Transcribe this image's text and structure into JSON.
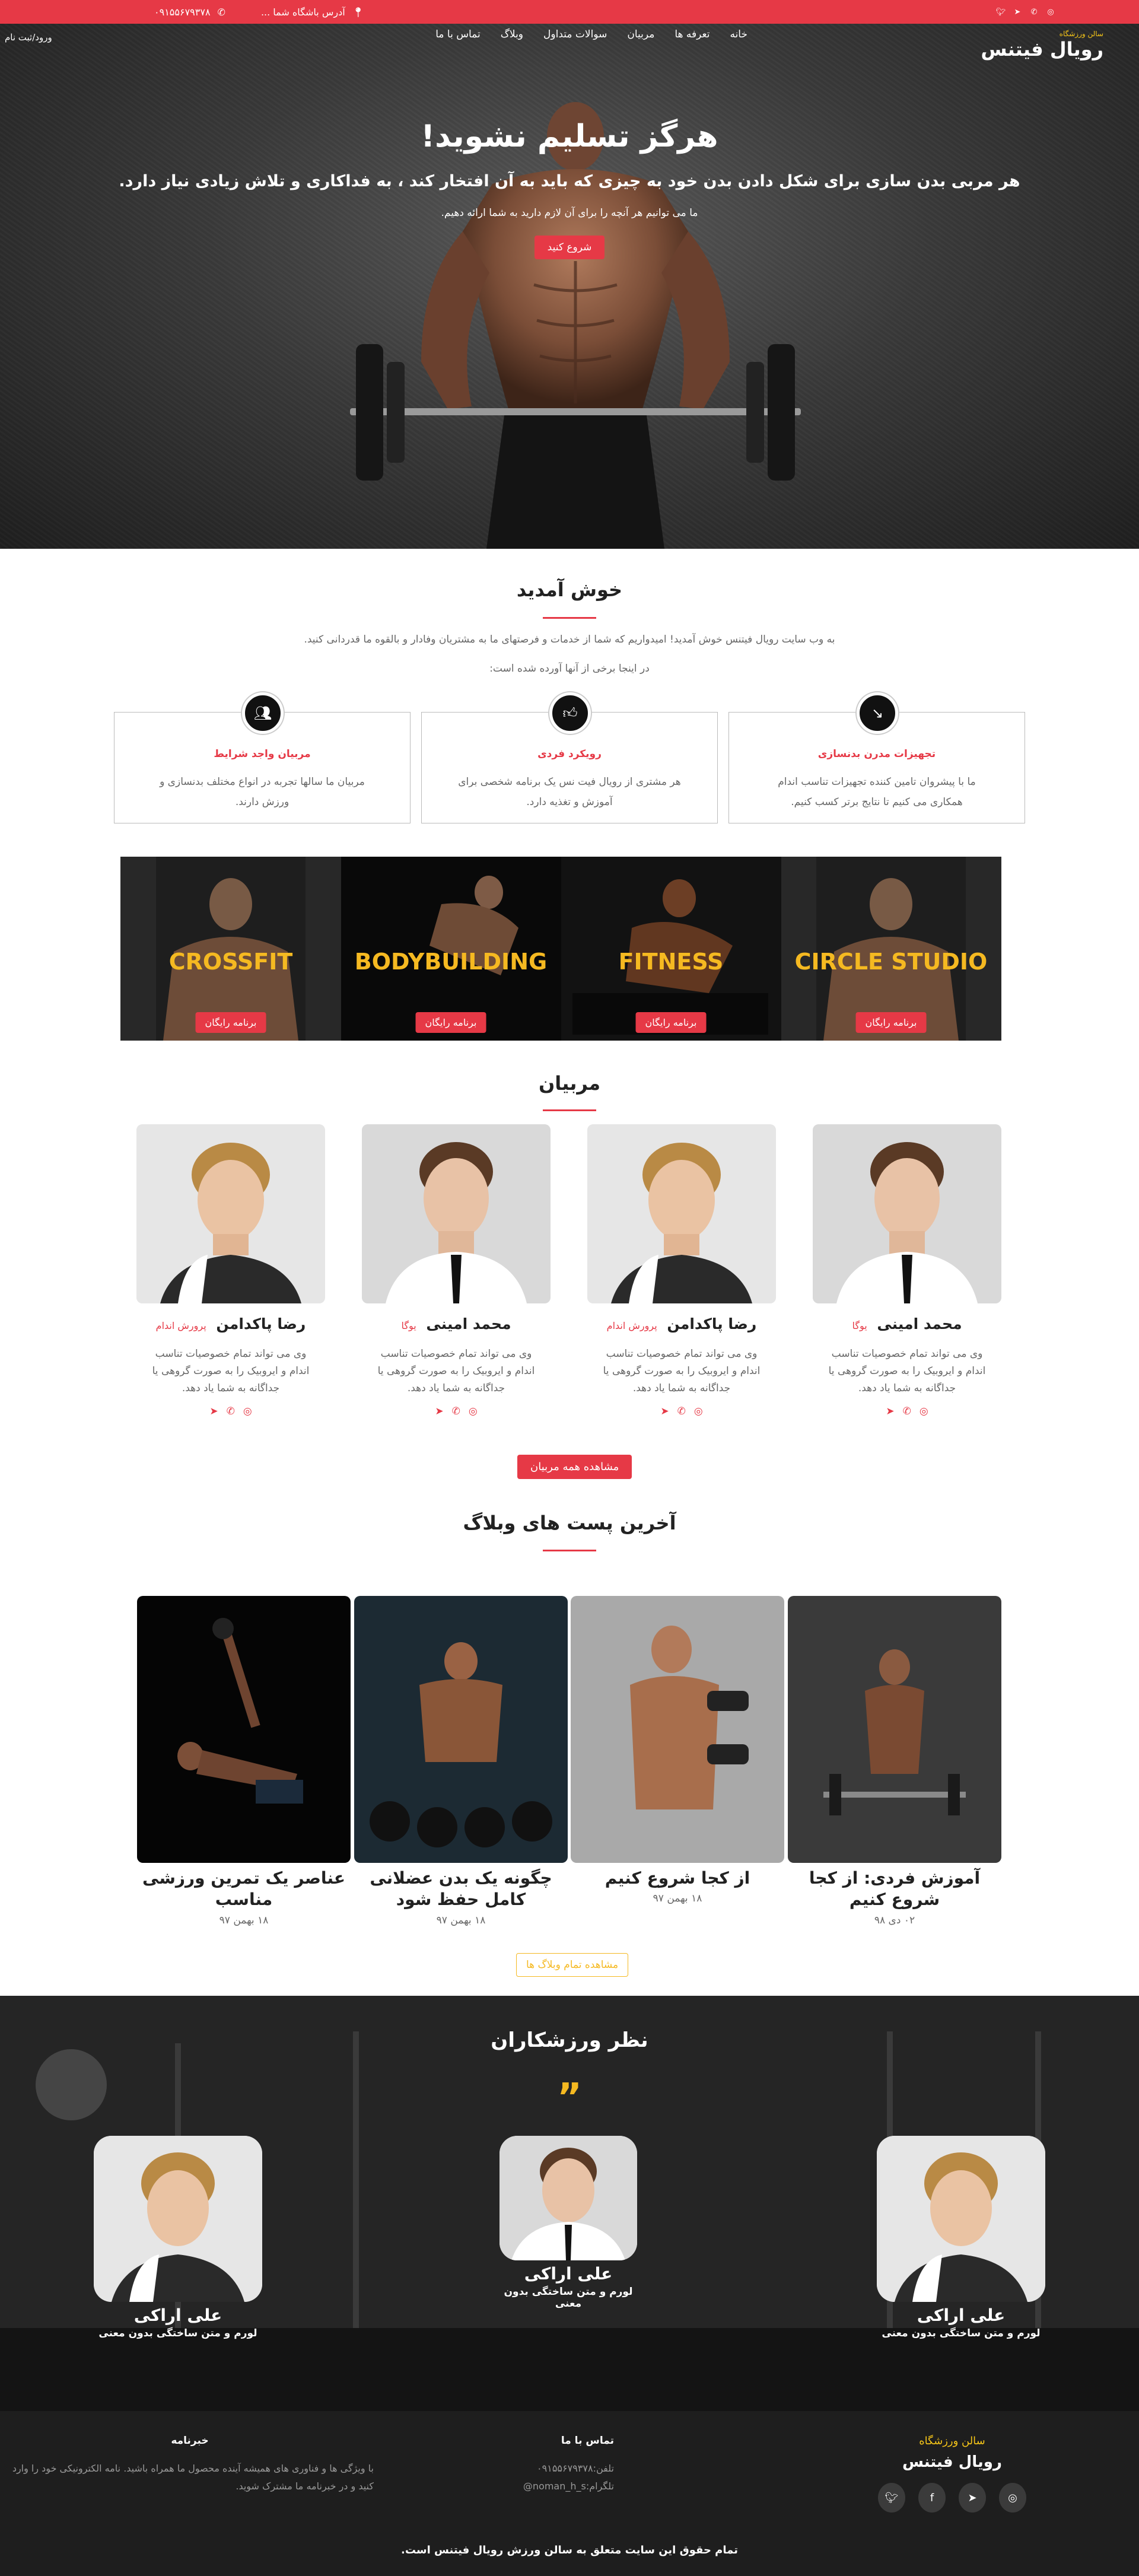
{
  "topbar": {
    "phone": "۰۹۱۵۵۶۷۹۳۷۸",
    "address": "آدرس باشگاه شما ...",
    "social": [
      "instagram-icon",
      "whatsapp-icon",
      "telegram-icon",
      "twitter-icon"
    ]
  },
  "nav": {
    "brand_tag": "سالن ورزشگاه",
    "brand_name": "رویال فیتنس",
    "menu": [
      "خانه",
      "تعرفه ها",
      "مربیان",
      "سوالات متداول",
      "وبلاگ",
      "تماس با ما"
    ],
    "login": "ورود/ثبت نام"
  },
  "hero": {
    "title": "هرگز تسلیم نشوید!",
    "lead": "هر مربی بدن سازی برای شکل دادن بدن خود به چیزی که باید به آن افتخار کند ، به فداکاری و تلاش زیادی نیاز دارد.",
    "sub": "ما می توانیم هر آنچه را برای آن لازم دارید به شما ارائه دهیم.",
    "cta": "شروع کنید"
  },
  "welcome": {
    "title": "خوش آمدید",
    "p1": "به وب سایت رویال فیتنس خوش آمدید! امیدواریم که شما از خدمات و فرصتهای ما به مشتریان وفادار و بالقوه ما قدردانی کنید.",
    "p2": "در اینجا برخی از آنها آورده شده است:",
    "cards": [
      {
        "title": "تجهیزات مدرن بدنسازی",
        "text": "ما با پیشروان تامین کننده تجهیزات تناسب اندام همکاری می کنیم تا نتایج برتر کسب کنیم.",
        "icon": "dumbbell-icon"
      },
      {
        "title": "رویکرد فردی",
        "text": "هر مشتری از رویال فیت نس یک برنامه شخصی برای آموزش و تغذیه دارد.",
        "icon": "thumbs-up-icon"
      },
      {
        "title": "مربیان واجد شرایط",
        "text": "مربیان ما سالها تجربه در انواع مختلف بدنسازی و ورزش دارند.",
        "icon": "users-icon"
      }
    ]
  },
  "programs": [
    {
      "label": "CIRCLE STUDIO",
      "button": "برنامه رایگان"
    },
    {
      "label": "FITNESS",
      "button": "برنامه رایگان"
    },
    {
      "label": "BODYBUILDING",
      "button": "برنامه رایگان"
    },
    {
      "label": "CROSSFIT",
      "button": "برنامه رایگان"
    }
  ],
  "trainers": {
    "title": "مربیان",
    "items": [
      {
        "name": "محمد امینی",
        "spec": "یوگا",
        "desc": "وی می تواند تمام خصوصیات تناسب اندام و ایروبیک را به صورت گروهی یا جداگانه به شما یاد دهد."
      },
      {
        "name": "رضا پاکدامن",
        "spec": "پرورش اندام",
        "desc": "وی می تواند تمام خصوصیات تناسب اندام و ایروبیک را به صورت گروهی یا جداگانه به شما یاد دهد."
      },
      {
        "name": "محمد امینی",
        "spec": "یوگا",
        "desc": "وی می تواند تمام خصوصیات تناسب اندام و ایروبیک را به صورت گروهی یا جداگانه به شما یاد دهد."
      },
      {
        "name": "رضا پاکدامن",
        "spec": "پرورش اندام",
        "desc": "وی می تواند تمام خصوصیات تناسب اندام و ایروبیک را به صورت گروهی یا جداگانه به شما یاد دهد."
      }
    ],
    "see_all": "مشاهده همه مربیان"
  },
  "blog": {
    "title": "آخرین پست های وبلاگ",
    "posts": [
      {
        "title": "آموزش فردی: از کجا شروع کنیم",
        "date": "۰۲ دی ۹۸"
      },
      {
        "title": "از کجا شروع کنیم",
        "date": "۱۸ بهمن ۹۷"
      },
      {
        "title": "چگونه یک بدن عضلانی کامل حفظ شود",
        "date": "۱۸ بهمن ۹۷"
      },
      {
        "title": "عناصر یک تمرین ورزشی مناسب",
        "date": "۱۸ بهمن ۹۷"
      }
    ],
    "see_all": "مشاهده تمام وبلاگ ها"
  },
  "testimonials": {
    "title": "نظر ورزشکاران",
    "quote": "”",
    "items": [
      {
        "name": "علی اراکی",
        "text": "لورم و متن ساختگی بدون معنی"
      },
      {
        "name": "علی اراکی",
        "text": "لورم و متن ساختگی بدون معنی"
      },
      {
        "name": "علی اراکی",
        "text": "لورم و متن ساختگی بدون معنی"
      }
    ]
  },
  "footer": {
    "brand_tag": "سالن ورزشگاه",
    "brand_name": "رویال فیتنس",
    "contact_title": "تماس با ما",
    "phone": "تلفن:۰۹۱۵۵۶۷۹۳۷۸",
    "telegram": "تلگرام:noman_h_s@",
    "news_title": "خبرنامه",
    "news_text": "با ویژگی ها و فناوری های همیشه آینده محصول ما همراه باشید. نامه الکترونیکی خود را وارد کنید و در خبرنامه ما مشترک شوید.",
    "copyright": "تمام حقوق این سایت متعلق به سالن ورزش رویال فیتنس است."
  },
  "colors": {
    "accent": "#e63946",
    "gold": "#f5b921",
    "dark": "#1e1e1e"
  }
}
